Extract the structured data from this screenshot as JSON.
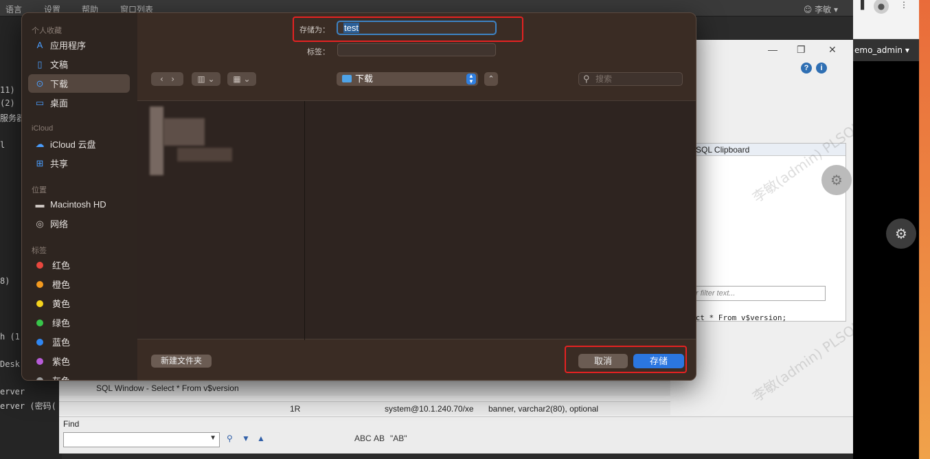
{
  "background": {
    "menu": [
      "语言",
      "设置",
      "帮助",
      "窗口列表"
    ],
    "user_label": "李敏",
    "terminal_lines": [
      "11)",
      "(2)",
      "服务器",
      "l",
      "8)",
      "h (1",
      "Desk",
      "erver",
      "erver (密码("
    ],
    "plsql": {
      "clipboard_title": "SQL Clipboard",
      "filter_placeholder": "r filter text...",
      "sql_text": "ect * From v$version;",
      "sql_window_tab": "SQL Window - Select * From v$version",
      "status_rows": "1R",
      "status_conn": "system@10.1.240.70/xe",
      "status_col": "banner, varchar2(80), optional",
      "find_label": "Find",
      "find_tools": [
        "ABC",
        "AB",
        "\"AB\""
      ]
    },
    "browser_user": "emo_admin",
    "watermark": "李敏(admin) PLSQL"
  },
  "dialog": {
    "sidebar": {
      "favorites_header": "个人收藏",
      "favorites": [
        {
          "label": "应用程序",
          "icon": "applications-icon",
          "glyph": "A"
        },
        {
          "label": "文稿",
          "icon": "document-icon",
          "glyph": "▭"
        },
        {
          "label": "下载",
          "icon": "downloads-icon",
          "glyph": "⊙",
          "selected": true
        },
        {
          "label": "桌面",
          "icon": "desktop-icon",
          "glyph": "▭"
        }
      ],
      "icloud_header": "iCloud",
      "icloud": [
        {
          "label": "iCloud 云盘",
          "icon": "cloud-icon",
          "glyph": "☁"
        },
        {
          "label": "共享",
          "icon": "shared-folder-icon",
          "glyph": "⊞"
        }
      ],
      "locations_header": "位置",
      "locations": [
        {
          "label": "Macintosh HD",
          "icon": "disk-icon",
          "glyph": "▬"
        },
        {
          "label": "网络",
          "icon": "network-icon",
          "glyph": "◎"
        }
      ],
      "tags_header": "标签",
      "tags": [
        {
          "label": "红色",
          "color": "#e8473e"
        },
        {
          "label": "橙色",
          "color": "#f39a1f"
        },
        {
          "label": "黄色",
          "color": "#f5d31d"
        },
        {
          "label": "绿色",
          "color": "#38c54a"
        },
        {
          "label": "蓝色",
          "color": "#2f86f2"
        },
        {
          "label": "紫色",
          "color": "#b85cd8"
        },
        {
          "label": "灰色",
          "color": "#9a9a9a"
        }
      ]
    },
    "save_as_label": "存储为：",
    "save_as_value": "test",
    "tags_label": "标签：",
    "location": "下载",
    "search_placeholder": "搜索",
    "new_folder": "新建文件夹",
    "cancel": "取消",
    "save": "存储"
  }
}
